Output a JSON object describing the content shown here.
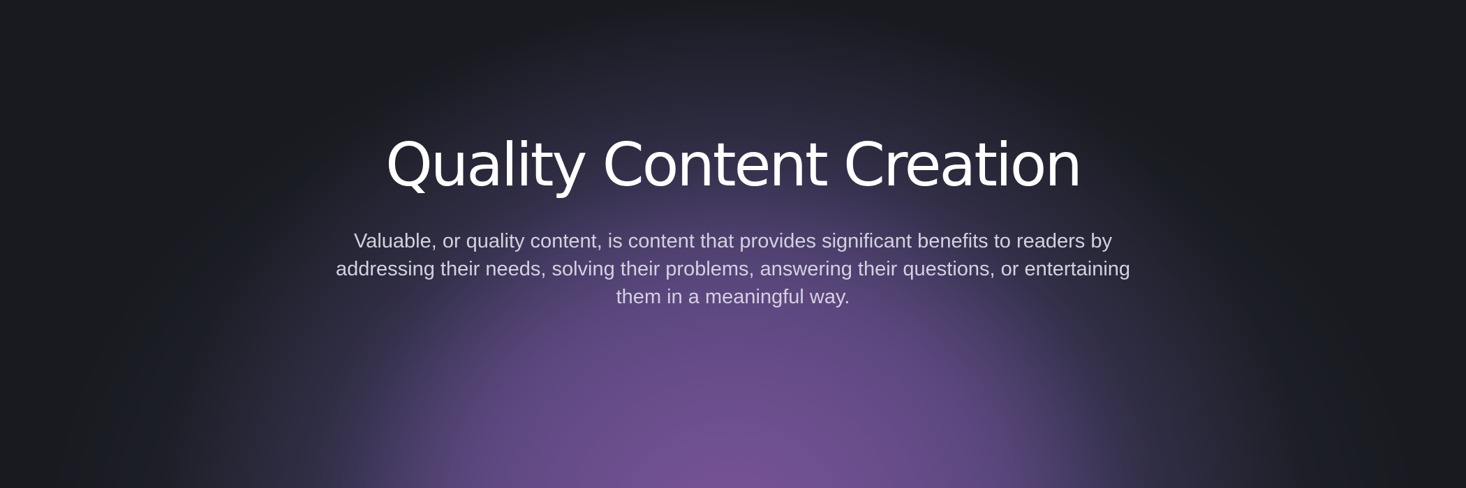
{
  "hero": {
    "title": "Quality Content Creation",
    "description": "Valuable, or quality content, is content that provides significant benefits to readers by addressing their needs, solving their problems, answering their questions, or entertaining them in a meaningful way."
  },
  "colors": {
    "background": "#181a20",
    "glow_purple": "#624e96",
    "glow_pink": "#805496",
    "title_text": "#ffffff",
    "description_text": "#d4d1df"
  }
}
